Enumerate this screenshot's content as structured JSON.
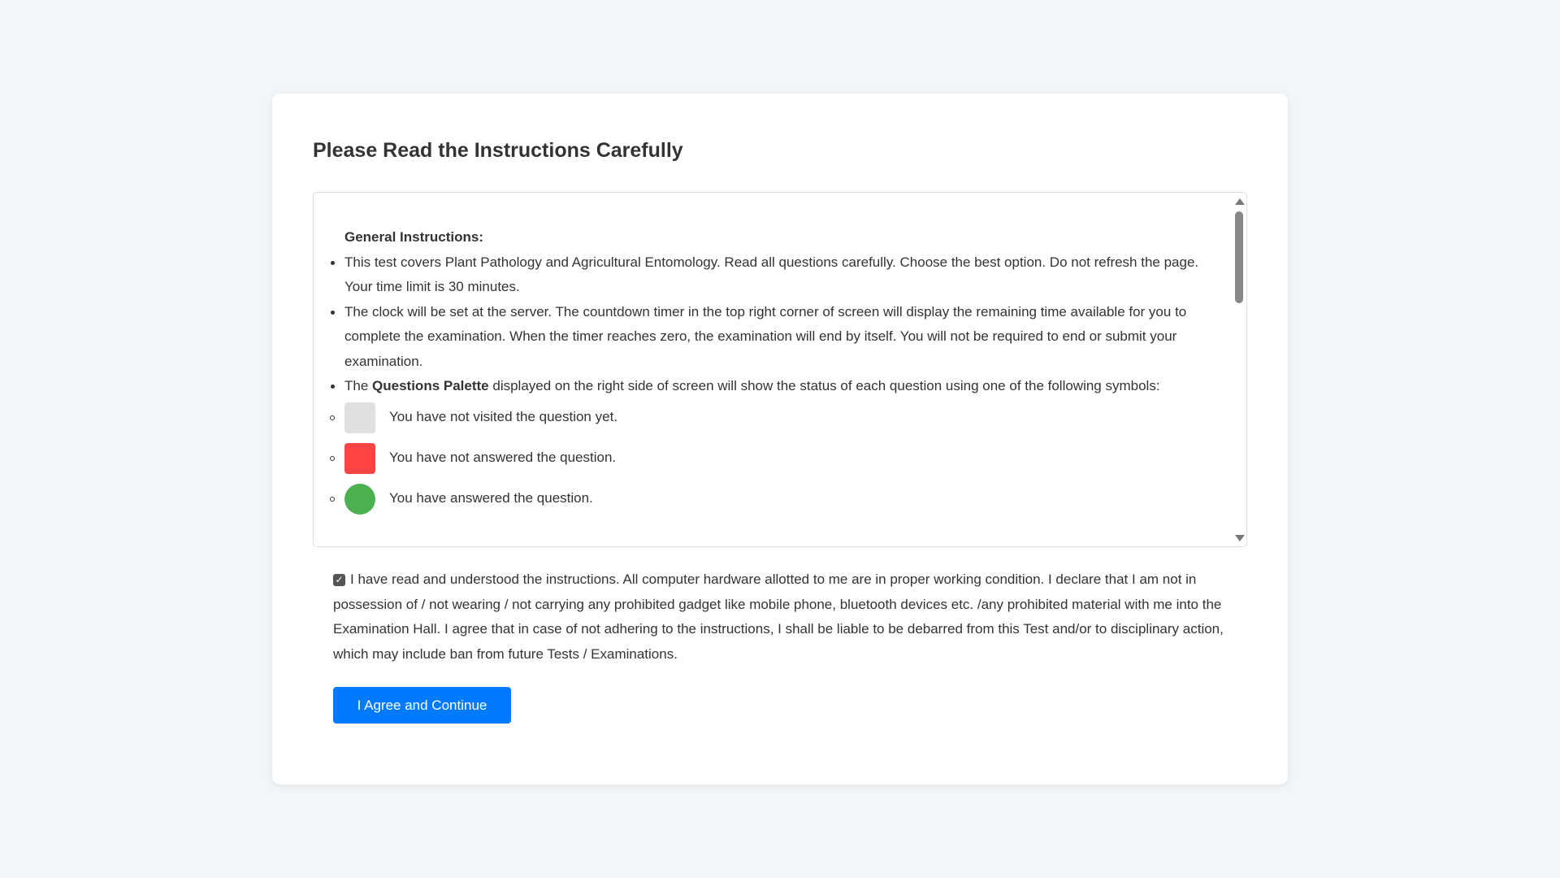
{
  "page": {
    "title": "Please Read the Instructions Carefully"
  },
  "instructions": {
    "heading": "General Instructions:",
    "items": [
      "This test covers Plant Pathology and Agricultural Entomology. Read all questions carefully. Choose the best option. Do not refresh the page. Your time limit is 30 minutes.",
      "The clock will be set at the server. The countdown timer in the top right corner of screen will display the remaining time available for you to complete the examination. When the timer reaches zero, the examination will end by itself. You will not be required to end or submit your examination."
    ],
    "palette_item": {
      "prefix": "The ",
      "bold": "Questions Palette",
      "suffix": " displayed on the right side of screen will show the status of each question using one of the following symbols:"
    },
    "symbols": [
      {
        "label": "You have not visited the question yet.",
        "color": "#e0e0e0"
      },
      {
        "label": "You have not answered the question.",
        "color": "#ff4444"
      },
      {
        "label": "You have answered the question.",
        "color": "#4caf50"
      }
    ]
  },
  "declaration": {
    "checked": true,
    "text": "I have read and understood the instructions. All computer hardware allotted to me are in proper working condition. I declare that I am not in possession of / not wearing / not carrying any prohibited gadget like mobile phone, bluetooth devices etc. /any prohibited material with me into the Examination Hall. I agree that in case of not adhering to the instructions, I shall be liable to be debarred from this Test and/or to disciplinary action, which may include ban from future Tests / Examinations."
  },
  "actions": {
    "agree_label": "I Agree and Continue",
    "accent_color": "#007bff"
  }
}
